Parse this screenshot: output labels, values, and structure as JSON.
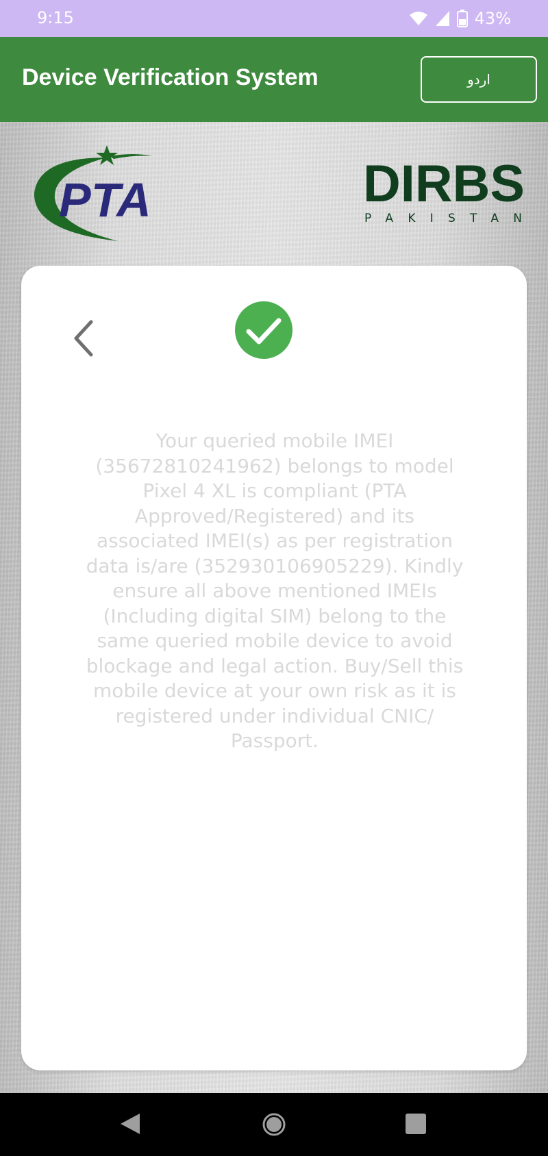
{
  "status_bar": {
    "time": "9:15",
    "battery_text": "43%"
  },
  "app_bar": {
    "title": "Device Verification System",
    "language_button_label": "اردو"
  },
  "logos": {
    "left": "PTA",
    "right_main": "DIRBS",
    "right_sub": "PAKISTAN"
  },
  "card": {
    "status": "success",
    "message": "Your queried mobile IMEI (35672810241962) belongs to model Pixel 4 XL is compliant (PTA Approved/Registered) and its associated IMEI(s) as per registration data is/are (352930106905229). Kindly ensure all above mentioned IMEIs (Including digital SIM) belong to the same queried mobile device to avoid blockage and legal action. Buy/Sell this mobile device at your own risk as it is registered under individual CNIC/ Passport."
  },
  "colors": {
    "status_bar": "#cdb8f4",
    "app_bar": "#3e8a3e",
    "check": "#4caf50",
    "pta_blue": "#2b2a7a",
    "pta_green": "#1e6a25",
    "dirbs_green": "#0f3d1e"
  },
  "icons": {
    "back": "chevron-left-icon",
    "success": "check-circle-icon",
    "wifi": "wifi-icon",
    "signal": "signal-icon",
    "battery": "battery-icon"
  }
}
